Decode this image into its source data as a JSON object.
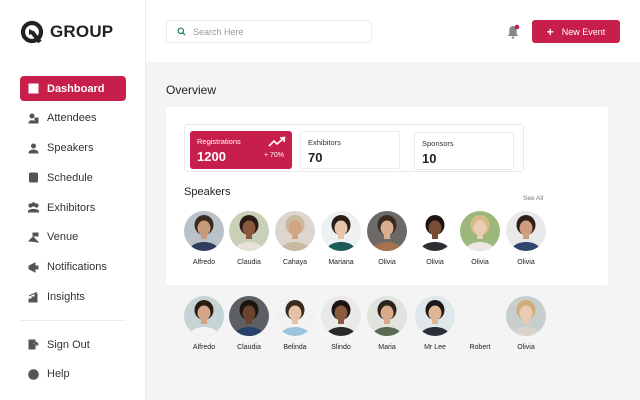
{
  "brand": {
    "name": "GROUP",
    "accent": "#c81e4b"
  },
  "sidebar": {
    "items": [
      {
        "label": "Dashboard",
        "icon": "grid-icon",
        "active": true
      },
      {
        "label": "Attendees",
        "icon": "attendee-icon"
      },
      {
        "label": "Speakers",
        "icon": "speaker-icon"
      },
      {
        "label": "Schedule",
        "icon": "schedule-icon"
      },
      {
        "label": "Exhibitors",
        "icon": "exhibitor-icon"
      },
      {
        "label": "Venue",
        "icon": "venue-icon"
      },
      {
        "label": "Notifications",
        "icon": "megaphone-icon"
      },
      {
        "label": "Insights",
        "icon": "bar-chart-icon"
      }
    ],
    "bottom": [
      {
        "label": "Sign Out",
        "icon": "sign-out-icon"
      },
      {
        "label": "Help",
        "icon": "help-icon"
      }
    ]
  },
  "topbar": {
    "search_placeholder": "Search Here",
    "new_event_label": "New Event"
  },
  "overview": {
    "title": "Overview",
    "stats": {
      "registrations": {
        "label": "Registrations",
        "value": "1200",
        "change": "+ 70%"
      },
      "exhibitors": {
        "label": "Exhibitors",
        "value": "70"
      },
      "sponsors": {
        "label": "Sponsors",
        "value": "10"
      }
    }
  },
  "speakers": {
    "title": "Speakers",
    "see_all": "See All",
    "row1": [
      {
        "name": "Alfredo",
        "bg": "#b9c1c9",
        "skin": "#c79a7c",
        "hair": "#3a2a22",
        "shirt": "#2f3e5a"
      },
      {
        "name": "Claudia",
        "bg": "#c8d0b8",
        "skin": "#8a5a3e",
        "hair": "#2a1b14",
        "shirt": "#e7e2d8"
      },
      {
        "name": "Cahaya",
        "bg": "#dcd6cf",
        "skin": "#d2a582",
        "hair": "#c9b9a0",
        "shirt": "#c9b9a0"
      },
      {
        "name": "Mariana",
        "bg": "#eef1f2",
        "skin": "#e8c4ad",
        "hair": "#2a1d17",
        "shirt": "#1d5a58"
      },
      {
        "name": "Olivia",
        "bg": "#6b6a68",
        "skin": "#d9ad8e",
        "hair": "#3c2a20",
        "shirt": "#a6714f"
      },
      {
        "name": "Olivia",
        "bg": "#ffffff",
        "skin": "#7a4e36",
        "hair": "#1b1410",
        "shirt": "#2d2d33"
      },
      {
        "name": "Olivia",
        "bg": "#9bb87a",
        "skin": "#ebcdb6",
        "hair": "#d9bb87",
        "shirt": "#ece8e1"
      },
      {
        "name": "Olivia",
        "bg": "#e9e9ea",
        "skin": "#cf9d7c",
        "hair": "#2d2019",
        "shirt": "#30466e"
      }
    ],
    "row2": [
      {
        "name": "Alfredo",
        "bg": "#c7d4d6",
        "skin": "#d3a487",
        "hair": "#2a1c15",
        "shirt": "#f4f4f4"
      },
      {
        "name": "Claudia",
        "bg": "#5c5f63",
        "skin": "#6a422d",
        "hair": "#1c130f",
        "shirt": "#27406b"
      },
      {
        "name": "Belinda",
        "bg": "#f2f2f2",
        "skin": "#e6c1a6",
        "hair": "#3a291e",
        "shirt": "#9bc4de"
      },
      {
        "name": "Slindo",
        "bg": "#e9e9e9",
        "skin": "#8a5b40",
        "hair": "#1c1411",
        "shirt": "#2a2a2a"
      },
      {
        "name": "Maria",
        "bg": "#e1e3df",
        "skin": "#d8a98a",
        "hair": "#2e221c",
        "shirt": "#5b6a55"
      },
      {
        "name": "Mr Lee",
        "bg": "#dfe7ea",
        "skin": "#e0b795",
        "hair": "#1d1815",
        "shirt": "#2b3038"
      },
      {
        "name": "Robert",
        "bg": "#ffffff",
        "skin": "#ffffff",
        "hair": "#ffffff",
        "shirt": "#ffffff"
      },
      {
        "name": "Olivia",
        "bg": "#c7cfcd",
        "skin": "#ebcbb2",
        "hair": "#cfae7c",
        "shirt": "#d9d5cd"
      }
    ]
  }
}
